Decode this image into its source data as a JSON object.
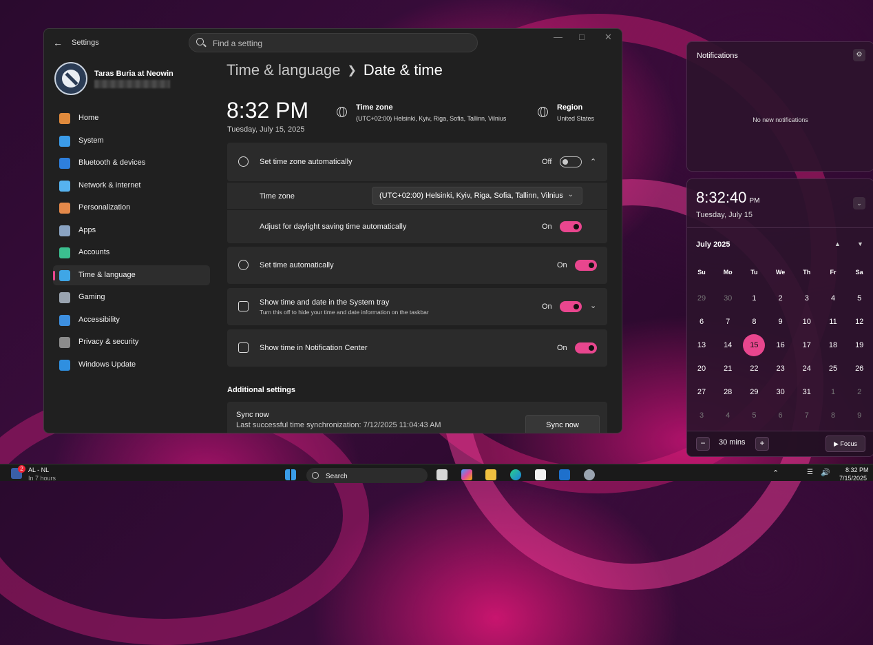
{
  "window": {
    "title": "Settings",
    "search_placeholder": "Find a setting"
  },
  "user": {
    "name": "Taras Buria at Neowin"
  },
  "nav": [
    {
      "label": "Home",
      "icon": "home-icon",
      "color": "#e08a3c"
    },
    {
      "label": "System",
      "icon": "system-icon",
      "color": "#3b9be8"
    },
    {
      "label": "Bluetooth & devices",
      "icon": "bluetooth-icon",
      "color": "#2e7fdc"
    },
    {
      "label": "Network & internet",
      "icon": "wifi-icon",
      "color": "#56b3f0"
    },
    {
      "label": "Personalization",
      "icon": "brush-icon",
      "color": "#e4894a"
    },
    {
      "label": "Apps",
      "icon": "apps-icon",
      "color": "#8aa3c2"
    },
    {
      "label": "Accounts",
      "icon": "accounts-icon",
      "color": "#3bbf8f"
    },
    {
      "label": "Time & language",
      "icon": "time-language-icon",
      "color": "#3fa6e6"
    },
    {
      "label": "Gaming",
      "icon": "gaming-icon",
      "color": "#9aa4b0"
    },
    {
      "label": "Accessibility",
      "icon": "accessibility-icon",
      "color": "#3d8fe0"
    },
    {
      "label": "Privacy & security",
      "icon": "shield-icon",
      "color": "#8c8c8c"
    },
    {
      "label": "Windows Update",
      "icon": "update-icon",
      "color": "#2f8fe0"
    }
  ],
  "breadcrumb": {
    "parent": "Time & language",
    "current": "Date & time"
  },
  "clock": {
    "time": "8:32 PM",
    "date": "Tuesday, July 15, 2025"
  },
  "timezone_header": {
    "label": "Time zone",
    "value": "(UTC+02:00) Helsinki, Kyiv, Riga, Sofia, Tallinn, Vilnius"
  },
  "region_header": {
    "label": "Region",
    "value": "United States"
  },
  "settings": {
    "tz_auto": {
      "label": "Set time zone automatically",
      "state": "Off"
    },
    "tz": {
      "label": "Time zone",
      "value": "(UTC+02:00) Helsinki, Kyiv, Riga, Sofia, Tallinn, Vilnius"
    },
    "dst": {
      "label": "Adjust for daylight saving time automatically",
      "state": "On"
    },
    "time_auto": {
      "label": "Set time automatically",
      "state": "On"
    },
    "tray": {
      "label": "Show time and date in the System tray",
      "desc": "Turn this off to hide your time and date information on the taskbar",
      "state": "On"
    },
    "notif_center": {
      "label": "Show time in Notification Center",
      "state": "On"
    }
  },
  "additional": {
    "heading": "Additional settings",
    "sync_label": "Sync now",
    "sync_desc": "Last successful time synchronization: 7/12/2025 11:04:43 AM",
    "sync_button": "Sync now"
  },
  "notifications": {
    "title": "Notifications",
    "empty": "No new notifications"
  },
  "calendar": {
    "time": "8:32:40",
    "ampm": "PM",
    "date": "Tuesday, July 15",
    "month": "July 2025",
    "weekdays": [
      "Su",
      "Mo",
      "Tu",
      "We",
      "Th",
      "Fr",
      "Sa"
    ],
    "days": [
      [
        "29",
        "30",
        "1",
        "2",
        "3",
        "4",
        "5"
      ],
      [
        "6",
        "7",
        "8",
        "9",
        "10",
        "11",
        "12"
      ],
      [
        "13",
        "14",
        "15",
        "16",
        "17",
        "18",
        "19"
      ],
      [
        "20",
        "21",
        "22",
        "23",
        "24",
        "25",
        "26"
      ],
      [
        "27",
        "28",
        "29",
        "30",
        "31",
        "1",
        "2"
      ],
      [
        "3",
        "4",
        "5",
        "6",
        "7",
        "8",
        "9"
      ]
    ],
    "today": "15",
    "focus_minutes": "30 mins",
    "focus_label": "Focus"
  },
  "taskbar": {
    "badge": "2",
    "weather_title": "AL - NL",
    "weather_sub": "In 7 hours",
    "search": "Search",
    "time": "8:32 PM",
    "date": "7/15/2025"
  }
}
